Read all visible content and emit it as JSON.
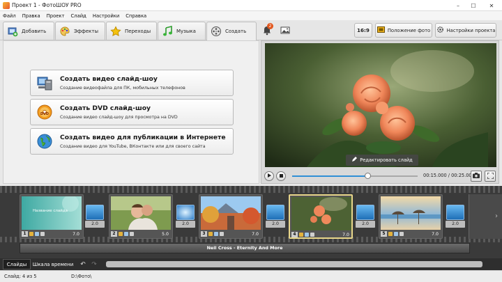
{
  "window": {
    "title": "Проект 1 - ФотоШОУ PRO",
    "minimize": "–",
    "maximize": "☐",
    "close": "✕"
  },
  "menu": [
    "Файл",
    "Правка",
    "Проект",
    "Слайд",
    "Настройки",
    "Справка"
  ],
  "tabs": [
    {
      "label": "Добавить",
      "icon": "add-photos-icon"
    },
    {
      "label": "Эффекты",
      "icon": "palette-icon"
    },
    {
      "label": "Переходы",
      "icon": "star-icon"
    },
    {
      "label": "Музыка",
      "icon": "music-icon"
    },
    {
      "label": "Создать",
      "icon": "film-reel-icon"
    }
  ],
  "notifications": {
    "count": "2"
  },
  "right_toolbar": {
    "aspect": "16:9",
    "photo_position": "Положение фото",
    "project_settings": "Настройки проекта"
  },
  "create_options": [
    {
      "title": "Создать видео слайд-шоу",
      "desc": "Создание видеофайла для ПК, мобильных телефонов",
      "icon": "computer-icon"
    },
    {
      "title": "Создать DVD слайд-шоу",
      "desc": "Создание видео слайд-шоу для просмотра на DVD",
      "icon": "dvd-icon"
    },
    {
      "title": "Создать видео для публикации в Интернете",
      "desc": "Создание видео для YouTube, ВКонтакте или для своего сайта",
      "icon": "globe-icon"
    }
  ],
  "preview": {
    "edit_label": "Редактировать слайд",
    "timecode": "00:15.000 / 00:25.000",
    "progress": 0.6
  },
  "slides": [
    {
      "num": "1",
      "dur": "7.0",
      "thumb_text": "Название слайда"
    },
    {
      "num": "2",
      "dur": "5.0"
    },
    {
      "num": "3",
      "dur": "7.0"
    },
    {
      "num": "4",
      "dur": "7.0"
    },
    {
      "num": "5",
      "dur": "7.0"
    }
  ],
  "transitions": [
    "2.0",
    "2.0",
    "2.0",
    "2.0",
    "2.0"
  ],
  "audio": {
    "track": "Neil Cross - Eternity And More"
  },
  "bottom_tabs": {
    "slides": "Слайды",
    "timeline": "Шкала времени"
  },
  "status": {
    "slide": "Слайд: 4 из 5",
    "path": "D:\\Фото\\"
  },
  "colors": {
    "accent": "#2f8fd6",
    "selected": "#e8d68a",
    "timeline_bg": "#3a3a3a"
  }
}
